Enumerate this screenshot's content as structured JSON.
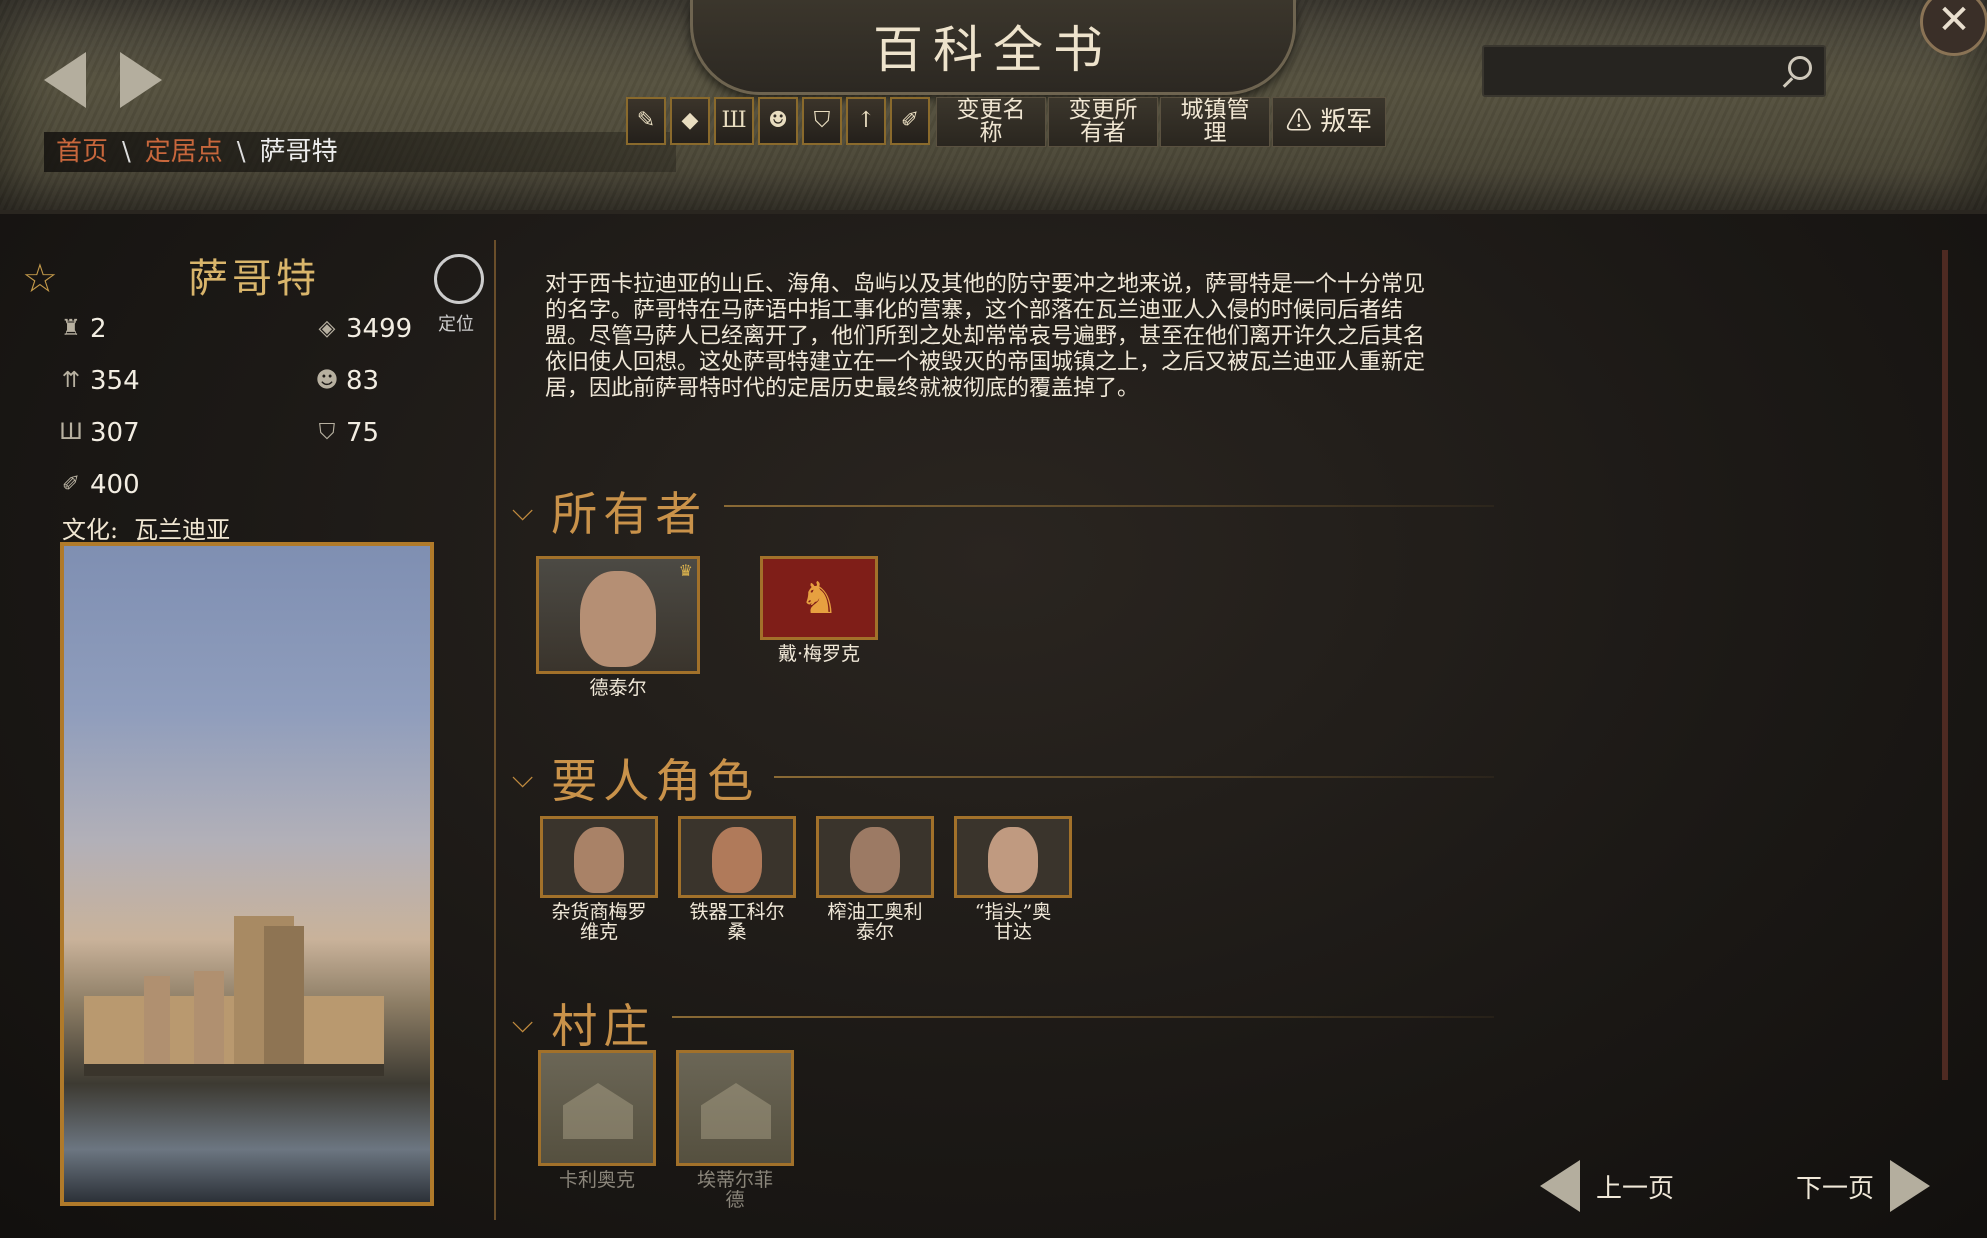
{
  "header": {
    "title": "百科全书",
    "breadcrumb": {
      "home": "首页",
      "section": "定居点",
      "current": "萨哥特",
      "separator": "\\"
    },
    "search": {
      "placeholder": ""
    },
    "close_glyph": "✕"
  },
  "toolbar": {
    "icons": [
      "quill-icon",
      "diamond-icon",
      "trident-icon",
      "mask-icon",
      "shield-icon",
      "spears-icon",
      "wheat-icon"
    ],
    "buttons": [
      {
        "line1": "变更名",
        "line2": "称"
      },
      {
        "line1": "变更所",
        "line2": "有者"
      },
      {
        "line1": "城镇管",
        "line2": "理"
      },
      {
        "line1": "⚠ 叛军",
        "line2": ""
      }
    ]
  },
  "settlement": {
    "name": "萨哥特",
    "locate_label": "定位",
    "stats": {
      "walls": "2",
      "prosperity": "3499",
      "garrison": "354",
      "loyalty": "83",
      "militia": "307",
      "security": "75",
      "food": "400"
    },
    "culture_label": "文化:",
    "culture_value": "瓦兰迪亚"
  },
  "description": "对于西卡拉迪亚的山丘、海角、岛屿以及其他的防守要冲之地来说，萨哥特是一个十分常见的名字。萨哥特在马萨语中指工事化的营寨，这个部落在瓦兰迪亚人入侵的时候同后者结盟。尽管马萨人已经离开了，他们所到之处却常常哀号遍野，甚至在他们离开许久之后其名依旧使人回想。这处萨哥特建立在一个被毁灭的帝国城镇之上，之后又被瓦兰迪亚人重新定居，因此前萨哥特时代的定居历史最终就被彻底的覆盖掉了。",
  "sections": {
    "owners": {
      "title": "所有者",
      "items": [
        {
          "name": "德泰尔"
        },
        {
          "name": "戴·梅罗克"
        }
      ]
    },
    "notables": {
      "title": "要人角色",
      "items": [
        {
          "line1": "杂货商梅罗",
          "line2": "维克"
        },
        {
          "line1": "铁器工科尔",
          "line2": "桑"
        },
        {
          "line1": "榨油工奥利",
          "line2": "泰尔"
        },
        {
          "line1": "“指头”奥",
          "line2": "甘达"
        }
      ]
    },
    "villages": {
      "title": "村庄",
      "items": [
        {
          "line1": "卡利奥克",
          "line2": ""
        },
        {
          "line1": "埃蒂尔菲",
          "line2": "德"
        }
      ]
    }
  },
  "pager": {
    "prev": "上一页",
    "next": "下一页"
  },
  "colors": {
    "accent": "#c9924a",
    "link": "#c8673c",
    "frame": "#a2712a",
    "banner": "#7f1e18"
  }
}
